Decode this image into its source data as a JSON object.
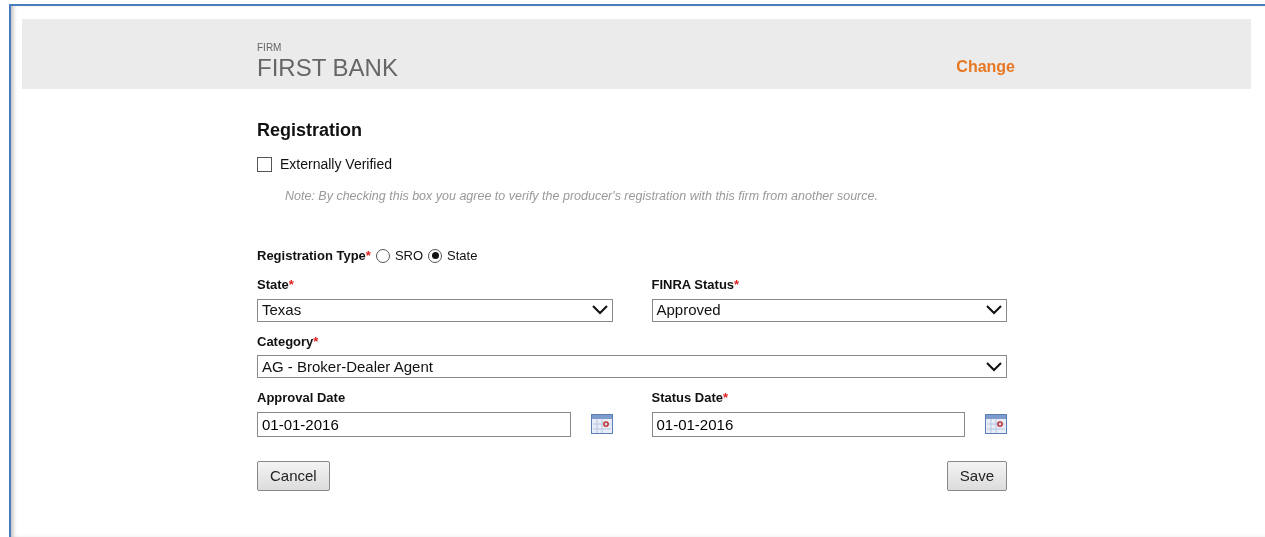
{
  "header": {
    "label": "FIRM",
    "firm_name": "FIRST BANK",
    "action": "Change"
  },
  "section_title": "Registration",
  "externally_verified": {
    "label": "Externally Verified",
    "checked": false,
    "note": "Note: By checking this box you agree to verify the producer's registration with this firm from another source."
  },
  "registration_type": {
    "label": "Registration Type",
    "required_mark": "*",
    "options": [
      {
        "label": "SRO",
        "selected": false
      },
      {
        "label": "State",
        "selected": true
      }
    ]
  },
  "rows": [
    [
      {
        "kind": "select",
        "label": "State",
        "required_mark": "*",
        "value": "Texas"
      },
      {
        "kind": "select",
        "label": "FINRA Status",
        "required_mark": "*",
        "value": "Approved"
      }
    ],
    [
      {
        "kind": "select",
        "label": "Category",
        "required_mark": "*",
        "value": "AG - Broker-Dealer Agent"
      }
    ],
    [
      {
        "kind": "date",
        "label": "Approval Date",
        "value": "01-01-2016"
      },
      {
        "kind": "date",
        "label": "Status Date",
        "required_mark": "*",
        "value": "01-01-2016"
      }
    ]
  ],
  "buttons": [
    "Cancel",
    "Save"
  ]
}
